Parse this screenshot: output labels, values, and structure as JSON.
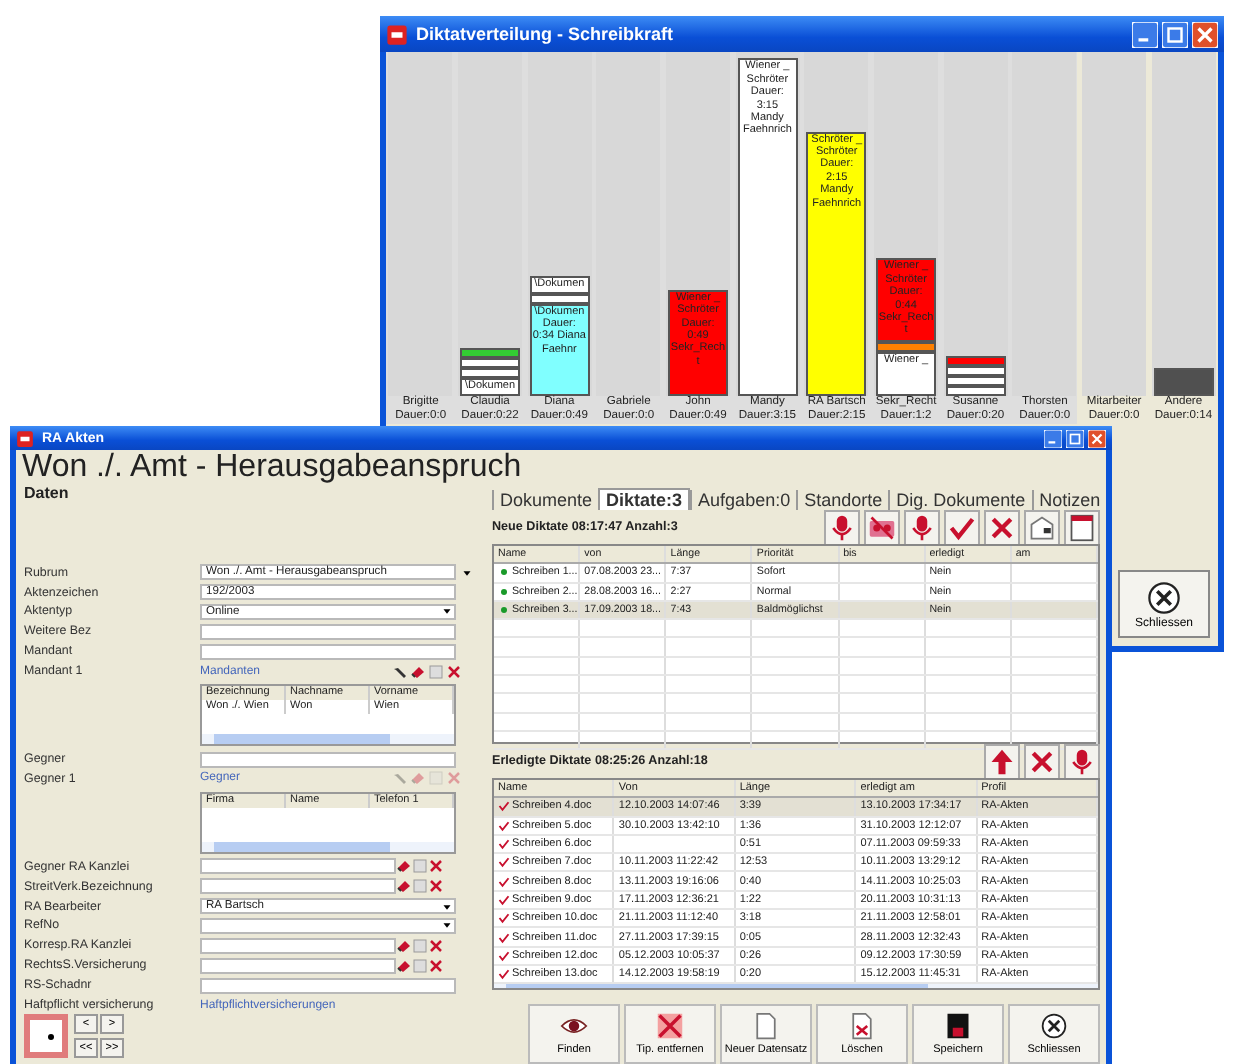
{
  "chart_window": {
    "title": "Diktatverteilung - Schreibkraft",
    "columns": [
      {
        "name": "Brigitte",
        "duration": "Dauer:0:0"
      },
      {
        "name": "Claudia",
        "duration": "Dauer:0:22",
        "blocks": [
          {
            "kind": "strip",
            "color": "#33cc33"
          },
          {
            "kind": "strip",
            "color": "#ffffff"
          },
          {
            "kind": "strip",
            "color": "#ffffff"
          },
          {
            "kind": "strip",
            "color": "#ffffff",
            "text": "\\Dokumen"
          }
        ]
      },
      {
        "name": "Diana",
        "duration": "Dauer:0:49",
        "blocks": [
          {
            "kind": "strip",
            "color": "#ffffff",
            "text": "\\Dokumen"
          },
          {
            "kind": "strip",
            "color": "#ffffff"
          },
          {
            "kind": "bar",
            "color": "#80ffff",
            "level": 0.27,
            "text": "\\Dokumen Dauer: 0:34 Diana Faehnr"
          }
        ]
      },
      {
        "name": "Gabriele",
        "duration": "Dauer:0:0"
      },
      {
        "name": "John",
        "duration": "Dauer:0:49",
        "blocks": [
          {
            "kind": "bar",
            "color": "#ff0000",
            "level": 0.31,
            "text": "Wiener _ Schröter Dauer: 0:49 Sekr_Recht"
          }
        ]
      },
      {
        "name": "Mandy",
        "duration": "Dauer:3:15",
        "blocks": [
          {
            "kind": "bar",
            "color": "#ffffff",
            "level": 0.98,
            "text": "Wiener _ Schröter Dauer: 3:15 Mandy Faehnrich"
          }
        ]
      },
      {
        "name": "RA Bartsch",
        "duration": "Dauer:2:15",
        "blocks": [
          {
            "kind": "bar",
            "color": "#ffff00",
            "level": 0.77,
            "text": "Schröter _ Schröter Dauer: 2:15 Mandy Faehnrich"
          }
        ]
      },
      {
        "name": "Sekr_Recht",
        "duration": "Dauer:1:2",
        "blocks": [
          {
            "kind": "bar",
            "color": "#ff0000",
            "level": 0.24,
            "text": "Wiener _ Schröter Dauer: 0:44 Sekr_Recht"
          },
          {
            "kind": "strip",
            "color": "#ff8000"
          },
          {
            "kind": "bar",
            "color": "#ffffff",
            "level": 0.13,
            "text": "Wiener _"
          }
        ]
      },
      {
        "name": "Susanne",
        "duration": "Dauer:0:20",
        "blocks": [
          {
            "kind": "strip",
            "color": "#ff0000"
          },
          {
            "kind": "strip",
            "color": "#ffffff"
          },
          {
            "kind": "strip",
            "color": "#ffffff"
          },
          {
            "kind": "strip",
            "color": "#ffffff"
          }
        ]
      },
      {
        "name": "Thorsten",
        "duration": "Dauer:0:0"
      },
      {
        "name": "Mitarbeiter",
        "duration": "Dauer:0:0"
      },
      {
        "name": "Andere",
        "duration": "Dauer:0:14",
        "blocks": [
          {
            "kind": "bar",
            "color": "#505050",
            "level": 0.08
          }
        ]
      }
    ],
    "close_button": "Schliessen"
  },
  "case_window": {
    "title": "RA Akten",
    "heading": "Won ./. Amt - Herausgabeanspruch",
    "section": "Daten",
    "form": [
      {
        "kind": "memo",
        "label": "Rubrum",
        "value": "Won ./. Amt - Herausgabeanspruch"
      },
      {
        "kind": "text",
        "label": "Aktenzeichen",
        "value": "192/2003"
      },
      {
        "kind": "combo",
        "label": "Aktentyp",
        "value": "Online"
      },
      {
        "kind": "text",
        "label": "Weitere Bez"
      },
      {
        "kind": "text",
        "label": "Mandant"
      },
      {
        "kind": "grid",
        "label": "Mandant 1",
        "link": "Mandanten",
        "disabled": false,
        "columns": [
          "Bezeichnung",
          "Nachname",
          "Vorname"
        ],
        "rows": [
          [
            "Won ./. Wien",
            "Won",
            "Wien"
          ]
        ]
      },
      {
        "kind": "text",
        "label": "Gegner"
      },
      {
        "kind": "grid",
        "label": "Gegner 1",
        "link": "Gegner",
        "disabled": true,
        "columns": [
          "Firma",
          "Name",
          "Telefon 1"
        ]
      },
      {
        "kind": "icons",
        "label": "Gegner RA Kanzlei"
      },
      {
        "kind": "icons",
        "label": "StreitVerk.Bezeichnung"
      },
      {
        "kind": "combo",
        "label": "RA Bearbeiter",
        "value": "RA Bartsch"
      },
      {
        "kind": "combo",
        "label": "RefNo"
      },
      {
        "kind": "icons",
        "label": "Korresp.RA Kanzlei"
      },
      {
        "kind": "icons",
        "label": "RechtsS.Versicherung"
      },
      {
        "kind": "text",
        "label": "RS-Schadnr"
      },
      {
        "kind": "link",
        "label": "Haftpflicht versicherung",
        "link": "Haftpflichtversicherungen"
      }
    ],
    "nav_buttons": [
      "<",
      ">",
      "<<",
      ">>"
    ],
    "tabs": [
      {
        "label": "Dokumente",
        "selected": false
      },
      {
        "label": "Diktate:3",
        "selected": true
      },
      {
        "label": "Aufgaben:0",
        "selected": false
      },
      {
        "label": "Standorte",
        "selected": false
      },
      {
        "label": "Dig. Dokumente",
        "selected": false
      },
      {
        "label": "Notizen",
        "selected": false
      }
    ],
    "new_dictations": {
      "title": "Neue Diktate 08:17:47 Anzahl:3",
      "columns": [
        "Name",
        "von",
        "Länge",
        "Priorität",
        "bis",
        "erledigt",
        "am"
      ],
      "rows": [
        {
          "selected": false,
          "cells": [
            "Schreiben 1...",
            "07.08.2003 23...",
            "7:37",
            "Sofort",
            null,
            "Nein",
            null
          ]
        },
        {
          "selected": false,
          "cells": [
            "Schreiben 2...",
            "28.08.2003 16...",
            "2:27",
            "Normal",
            null,
            "Nein",
            null
          ]
        },
        {
          "selected": true,
          "cells": [
            "Schreiben 3...",
            "17.09.2003 18...",
            "7:43",
            "Baldmöglichst",
            null,
            "Nein",
            null
          ]
        }
      ]
    },
    "done_dictations": {
      "title": "Erledigte Diktate 08:25:26 Anzahl:18",
      "columns": [
        "Name",
        "Von",
        "Länge",
        "erledigt am",
        "Profil"
      ],
      "rows": [
        {
          "selected": true,
          "cells": [
            "Schreiben 4.doc",
            "12.10.2003 14:07:46",
            "3:39",
            "13.10.2003 17:34:17",
            "RA-Akten"
          ]
        },
        {
          "selected": false,
          "cells": [
            "Schreiben 5.doc",
            "30.10.2003 13:42:10",
            "1:36",
            "31.10.2003 12:12:07",
            "RA-Akten"
          ]
        },
        {
          "selected": false,
          "cells": [
            "Schreiben 6.doc",
            null,
            "0:51",
            "07.11.2003 09:59:33",
            "RA-Akten"
          ]
        },
        {
          "selected": false,
          "cells": [
            "Schreiben 7.doc",
            "10.11.2003 11:22:42",
            "12:53",
            "10.11.2003 13:29:12",
            "RA-Akten"
          ]
        },
        {
          "selected": false,
          "cells": [
            "Schreiben 8.doc",
            "13.11.2003 19:16:06",
            "0:40",
            "14.11.2003 10:25:03",
            "RA-Akten"
          ]
        },
        {
          "selected": false,
          "cells": [
            "Schreiben 9.doc",
            "17.11.2003 12:36:21",
            "1:22",
            "20.11.2003 10:31:13",
            "RA-Akten"
          ]
        },
        {
          "selected": false,
          "cells": [
            "Schreiben 10.doc",
            "21.11.2003 11:12:40",
            "3:18",
            "21.11.2003 12:58:01",
            "RA-Akten"
          ]
        },
        {
          "selected": false,
          "cells": [
            "Schreiben 11.doc",
            "27.11.2003 17:39:15",
            "0:05",
            "28.11.2003 12:32:43",
            "RA-Akten"
          ]
        },
        {
          "selected": false,
          "cells": [
            "Schreiben 12.doc",
            "05.12.2003 10:05:37",
            "0:26",
            "09.12.2003 17:30:59",
            "RA-Akten"
          ]
        },
        {
          "selected": false,
          "cells": [
            "Schreiben 13.doc",
            "14.12.2003 19:58:19",
            "0:20",
            "15.12.2003 11:45:31",
            "RA-Akten"
          ]
        }
      ]
    },
    "toolbar": [
      "Finden",
      "Tip. entfernen",
      "Neuer Datensatz",
      "Löschen",
      "Speichern",
      "Schliessen"
    ]
  }
}
